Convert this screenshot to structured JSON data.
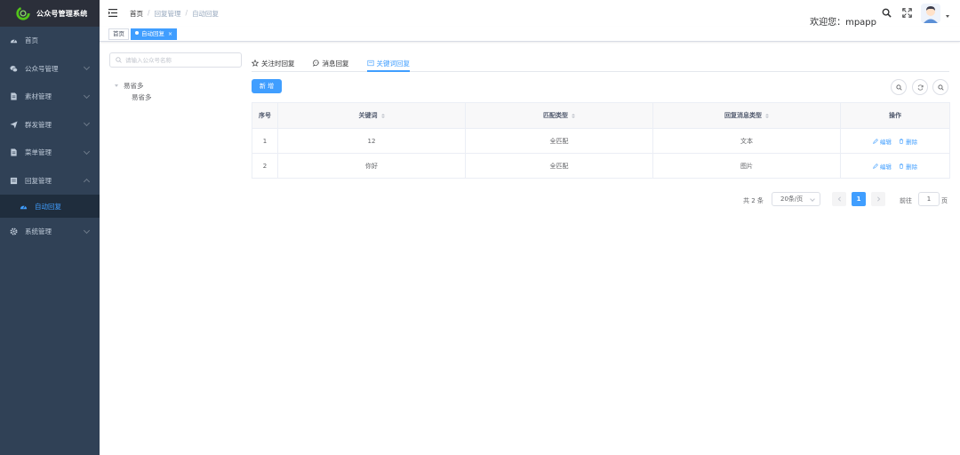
{
  "app": {
    "title": "公众号管理系统"
  },
  "sidebar": {
    "items": [
      {
        "label": "首页",
        "icon": "dashboard-icon",
        "has_children": false
      },
      {
        "label": "公众号管理",
        "icon": "wechat-icon",
        "has_children": true
      },
      {
        "label": "素材管理",
        "icon": "material-icon",
        "has_children": true
      },
      {
        "label": "群发管理",
        "icon": "send-icon",
        "has_children": true
      },
      {
        "label": "菜单管理",
        "icon": "menu-icon",
        "has_children": true
      },
      {
        "label": "回复管理",
        "icon": "reply-icon",
        "has_children": true,
        "expanded": true,
        "children": [
          {
            "label": "自动回复",
            "icon": "gauge-icon",
            "active": true
          }
        ]
      },
      {
        "label": "系统管理",
        "icon": "gear-icon",
        "has_children": true
      }
    ]
  },
  "header": {
    "breadcrumb": [
      "首页",
      "回复管理",
      "自动回复"
    ],
    "welcome": "欢迎您：mpapp"
  },
  "tags": [
    {
      "label": "首页",
      "active": false
    },
    {
      "label": "自动回复",
      "active": true,
      "close": "×"
    }
  ],
  "tree": {
    "search_placeholder": "请输入公众号名称",
    "root": "易省多",
    "children": [
      "易省多"
    ]
  },
  "tabs": [
    {
      "label": "关注时回复",
      "icon": "star-icon",
      "active": false
    },
    {
      "label": "消息回复",
      "icon": "chat-icon",
      "active": false
    },
    {
      "label": "关键词回复",
      "icon": "news-icon",
      "active": true
    }
  ],
  "toolbar": {
    "add_label": "新 增"
  },
  "table": {
    "headers": [
      "序号",
      "关键词",
      "匹配类型",
      "回复消息类型",
      "操作"
    ],
    "rows": [
      {
        "index": "1",
        "keyword": "12",
        "match": "全匹配",
        "type": "文本"
      },
      {
        "index": "2",
        "keyword": "你好",
        "match": "全匹配",
        "type": "图片"
      }
    ],
    "edit_label": "编辑",
    "delete_label": "删除"
  },
  "pagination": {
    "total": "共 2 条",
    "page_size": "20条/页",
    "current": "1",
    "goto": "前往",
    "goto_value": "1",
    "unit": "页"
  },
  "colors": {
    "primary": "#409eff",
    "sidebar_bg": "#304156",
    "sidebar_text": "#bfcbd9"
  }
}
